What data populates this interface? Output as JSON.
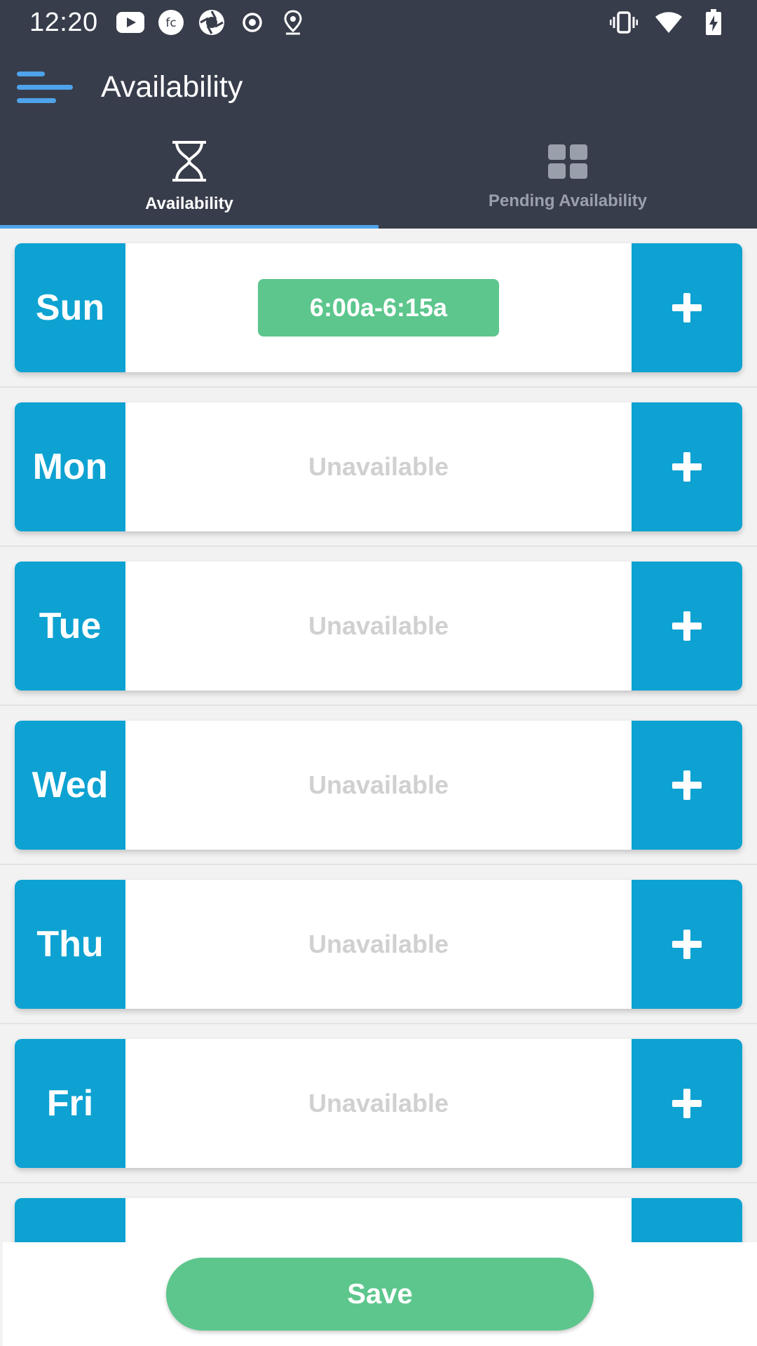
{
  "status_bar": {
    "time": "12:20",
    "left_icons": [
      "youtube-icon",
      "fc-app-icon",
      "camera-shutter-icon",
      "record-icon",
      "location-pin-icon"
    ],
    "right_icons": [
      "vibrate-icon",
      "wifi-icon",
      "battery-charging-icon"
    ]
  },
  "app_bar": {
    "title": "Availability"
  },
  "tabs": [
    {
      "label": "Availability",
      "icon": "hourglass-icon",
      "active": true
    },
    {
      "label": "Pending Availability",
      "icon": "grid-icon",
      "active": false
    }
  ],
  "days": [
    {
      "label": "Sun",
      "slot": "6:00a-6:15a"
    },
    {
      "label": "Mon",
      "status": "Unavailable"
    },
    {
      "label": "Tue",
      "status": "Unavailable"
    },
    {
      "label": "Wed",
      "status": "Unavailable"
    },
    {
      "label": "Thu",
      "status": "Unavailable"
    },
    {
      "label": "Fri",
      "status": "Unavailable"
    }
  ],
  "footer": {
    "save_label": "Save"
  },
  "colors": {
    "header_bg": "#383d4b",
    "accent_blue": "#4ea3ea",
    "day_blue": "#0da2d2",
    "green": "#5cc68d",
    "unavailable_text": "#d0d0d0"
  }
}
